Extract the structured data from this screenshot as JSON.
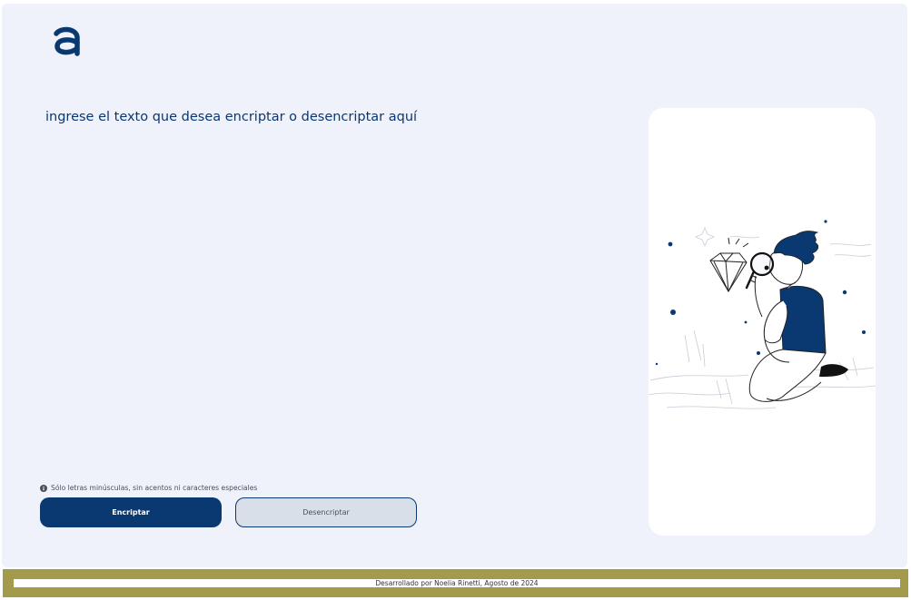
{
  "logo": {
    "icon": "alura-logo-icon",
    "color": "#0a3871"
  },
  "input": {
    "placeholder": "ingrese el texto que desea encriptar o desencriptar aquí",
    "value": ""
  },
  "hint": {
    "icon": "info-icon",
    "text": "Sólo letras minúsculas, sin acentos ni caracteres especiales"
  },
  "buttons": {
    "encrypt_label": "Encriptar",
    "decrypt_label": "Desencriptar"
  },
  "output_panel": {
    "illustration": "person-with-magnifying-glass-diamond-illustration"
  },
  "footer": {
    "text": "Desarrollado por Noelia Rinetti, Agosto de 2024"
  },
  "colors": {
    "primary": "#0a3871",
    "page_background": "#eff1fb",
    "footer_background": "#a49a4c",
    "secondary_button": "#d8dfe8"
  }
}
